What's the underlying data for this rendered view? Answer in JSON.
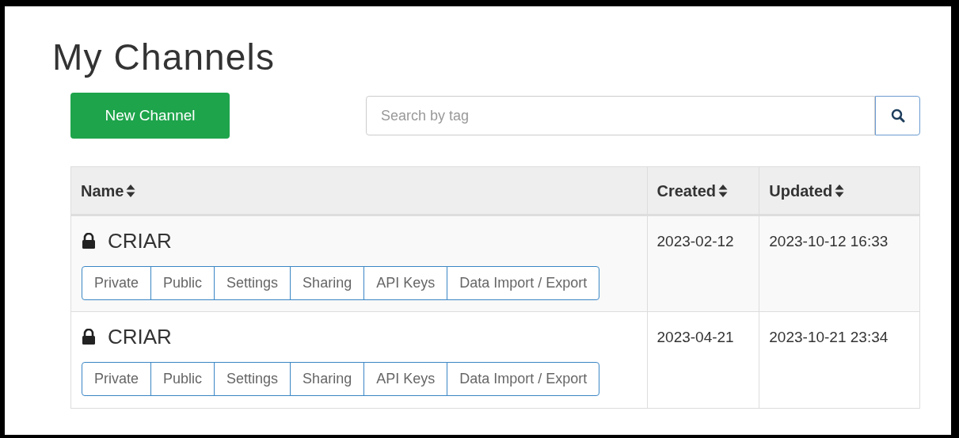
{
  "page_title": "My Channels",
  "new_button": "New Channel",
  "search": {
    "placeholder": "Search by tag"
  },
  "table": {
    "columns": [
      {
        "label": "Name"
      },
      {
        "label": "Created"
      },
      {
        "label": "Updated"
      }
    ],
    "rows": [
      {
        "name": "CRIAR",
        "private": true,
        "created": "2023-02-12",
        "updated": "2023-10-12 16:33",
        "actions": [
          "Private",
          "Public",
          "Settings",
          "Sharing",
          "API Keys",
          "Data Import / Export"
        ]
      },
      {
        "name": "CRIAR",
        "private": true,
        "created": "2023-04-21",
        "updated": "2023-10-21 23:34",
        "actions": [
          "Private",
          "Public",
          "Settings",
          "Sharing",
          "API Keys",
          "Data Import / Export"
        ]
      }
    ]
  }
}
